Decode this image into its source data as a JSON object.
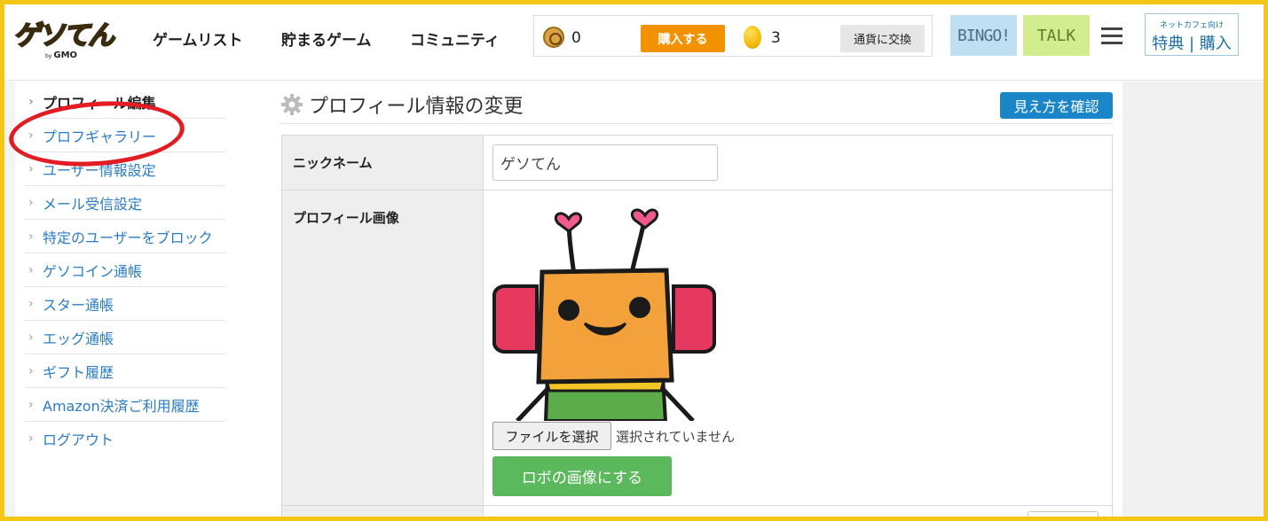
{
  "header": {
    "logo_text": "ゲソてん",
    "logo_by": "by",
    "logo_gmo": "GMO",
    "nav": [
      "ゲームリスト",
      "貯まるゲーム",
      "コミュニティ"
    ],
    "gesso_coin_value": "0",
    "buy_label": "購入する",
    "star_coin_value": "3",
    "exchange_label": "通貨に交換",
    "bingo_label": "BINGO!",
    "talk_label": "TALK",
    "cafe_small": "ネットカフェ向け",
    "cafe_main": "特典 | 購入"
  },
  "sidebar": {
    "items": [
      {
        "label": "プロフィール編集"
      },
      {
        "label": "プロフギャラリー"
      },
      {
        "label": "ユーザー情報設定"
      },
      {
        "label": "メール受信設定"
      },
      {
        "label": "特定のユーザーをブロック"
      },
      {
        "label": "ゲソコイン通帳"
      },
      {
        "label": "スター通帳"
      },
      {
        "label": "エッグ通帳"
      },
      {
        "label": "ギフト履歴"
      },
      {
        "label": "Amazon決済ご利用履歴"
      },
      {
        "label": "ログアウト"
      }
    ]
  },
  "main": {
    "title": "プロフィール情報の変更",
    "view_button": "見え方を確認",
    "nickname_label": "ニックネーム",
    "nickname_value": "ゲソてん",
    "image_label": "プロフィール画像",
    "file_button": "ファイルを選択",
    "file_status": "選択されていません",
    "robo_button": "ロボの画像にする"
  },
  "colors": {
    "frame": "#f5c518",
    "buy": "#f39200",
    "link": "#2a7cc6",
    "view_button": "#1a86c8",
    "robo_button": "#5cb85c",
    "highlight_circle": "#e31b23"
  }
}
